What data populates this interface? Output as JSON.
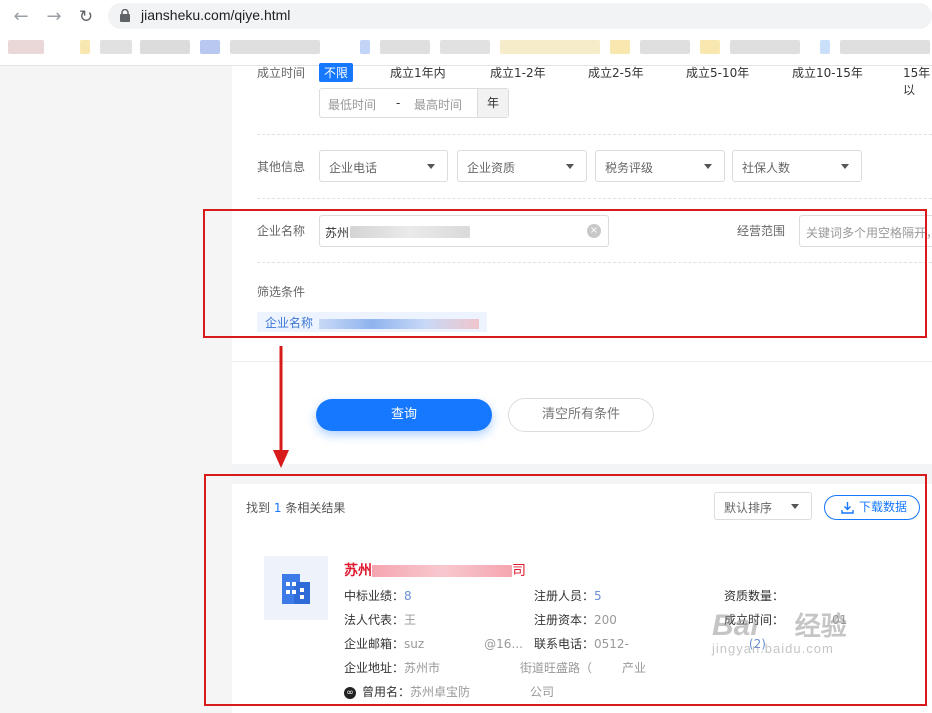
{
  "browser": {
    "url": "jiansheku.com/qiye.html"
  },
  "filters": {
    "founded": {
      "label": "成立时间",
      "options": [
        "不限",
        "成立1年内",
        "成立1-2年",
        "成立2-5年",
        "成立5-10年",
        "成立10-15年",
        "15年以"
      ],
      "active": "不限",
      "min_placeholder": "最低时间",
      "dash": "-",
      "max_placeholder": "最高时间",
      "unit": "年"
    },
    "other": {
      "label": "其他信息",
      "selects": [
        "企业电话",
        "企业资质",
        "税务评级",
        "社保人数"
      ]
    },
    "company_name": {
      "label": "企业名称",
      "value_prefix": "苏州"
    },
    "business_scope": {
      "label": "经营范围",
      "placeholder": "关键词多个用空格隔开，"
    },
    "conditions": {
      "label": "筛选条件",
      "tag_prefix": "企业名称"
    }
  },
  "actions": {
    "search": "查询",
    "clear": "清空所有条件"
  },
  "results": {
    "found_prefix": "找到",
    "count": "1",
    "found_suffix": "条相关结果",
    "sort": "默认排序",
    "download": "下载数据",
    "item": {
      "name_prefix": "苏州",
      "name_suffix": "司",
      "bid_label": "中标业绩：",
      "bid_value": "8",
      "staff_label": "注册人员：",
      "staff_value": "5",
      "qual_label": "资质数量：",
      "legal_label": "法人代表：",
      "legal_value": "王",
      "capital_label": "注册资本：",
      "capital_value": "200",
      "date_label": "成立时间：",
      "date_value": "01",
      "email_label": "企业邮箱：",
      "email_value_a": "suz",
      "email_value_b": "@16...",
      "phone_label": "联系电话：",
      "phone_value": "0512-",
      "phone_more": "(2)",
      "address_label": "企业地址：",
      "address_value_a": "苏州市",
      "address_value_b": "街道旺盛路（",
      "address_value_c": "产业",
      "former_label": "曾用名：",
      "former_value_a": "苏州卓宝防",
      "former_value_b": "公司"
    }
  },
  "watermark": {
    "brand": "Bai",
    "brand_b": "经验",
    "site": "jingyan.baidu.com"
  }
}
